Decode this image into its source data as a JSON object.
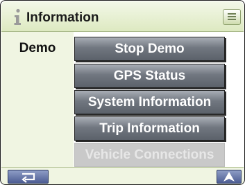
{
  "header": {
    "title": "Information",
    "info_icon": "info-icon",
    "menu_icon": "menu-icon"
  },
  "sidebar": {
    "label": "Demo"
  },
  "menu": {
    "items": [
      {
        "label": "Stop Demo",
        "enabled": true
      },
      {
        "label": "GPS Status",
        "enabled": true
      },
      {
        "label": "System Information",
        "enabled": true
      },
      {
        "label": "Trip Information",
        "enabled": true
      },
      {
        "label": "Vehicle Connections",
        "enabled": false
      }
    ]
  },
  "footer": {
    "back_icon": "return-arrow-icon",
    "nav_icon": "navigation-arrow-icon"
  },
  "colors": {
    "title_bar": "#dde9c1",
    "button": "#6b7179",
    "button_disabled": "#c9c9c9",
    "footer_button": "#5b6aa0"
  }
}
